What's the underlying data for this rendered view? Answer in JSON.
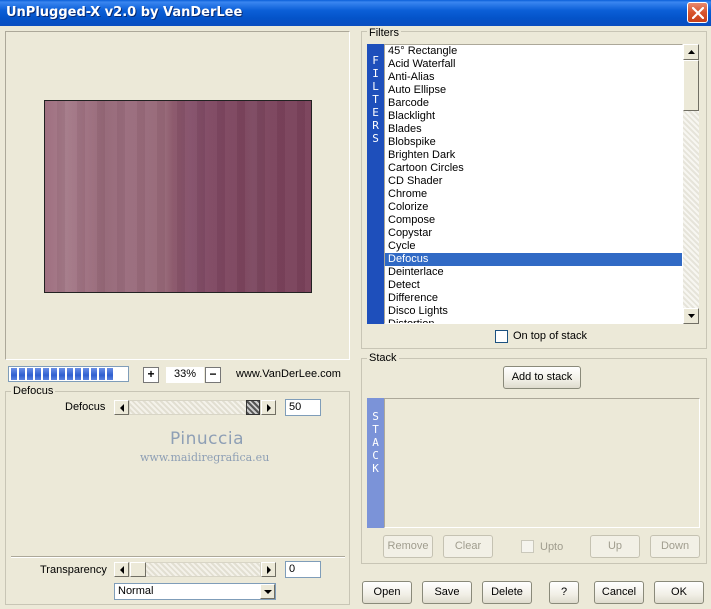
{
  "window": {
    "title": "UnPlugged-X v2.0 by VanDerLee"
  },
  "preview": {
    "zoom": "33%",
    "zoom_in": "+",
    "zoom_out": "−",
    "website": "www.VanDerLee.com",
    "progress_segments": 13
  },
  "params": {
    "group_label": "Defocus",
    "defocus_label": "Defocus",
    "defocus_value": "50",
    "watermark_name": "Pinuccia",
    "watermark_site": "www.maidiregrafica.eu",
    "transparency_label": "Transparency",
    "transparency_value": "0",
    "blend_mode": "Normal"
  },
  "filters": {
    "group_label": "Filters",
    "banner": [
      "F",
      "I",
      "L",
      "T",
      "E",
      "R",
      "S"
    ],
    "items": [
      "45° Rectangle",
      "Acid Waterfall",
      "Anti-Alias",
      "Auto Ellipse",
      "Barcode",
      "Blacklight",
      "Blades",
      "Blobspike",
      "Brighten Dark",
      "Cartoon Circles",
      "CD Shader",
      "Chrome",
      "Colorize",
      "Compose",
      "Copystar",
      "Cycle",
      "Defocus",
      "Deinterlace",
      "Detect",
      "Difference",
      "Disco Lights",
      "Distortion"
    ],
    "selected": "Defocus",
    "on_top_label": "On top of stack"
  },
  "stack": {
    "group_label": "Stack",
    "banner": [
      "S",
      "T",
      "A",
      "C",
      "K"
    ],
    "add_label": "Add to stack",
    "remove_label": "Remove",
    "clear_label": "Clear",
    "upto_label": "Upto",
    "up_label": "Up",
    "down_label": "Down"
  },
  "footer": {
    "open": "Open",
    "save": "Save",
    "delete": "Delete",
    "help": "?",
    "cancel": "Cancel",
    "ok": "OK"
  },
  "colors": {
    "titlebar": "#0a5fd8",
    "selection": "#316ac5",
    "banner": "#1e4fbb",
    "stack_banner": "#7b93d8"
  }
}
